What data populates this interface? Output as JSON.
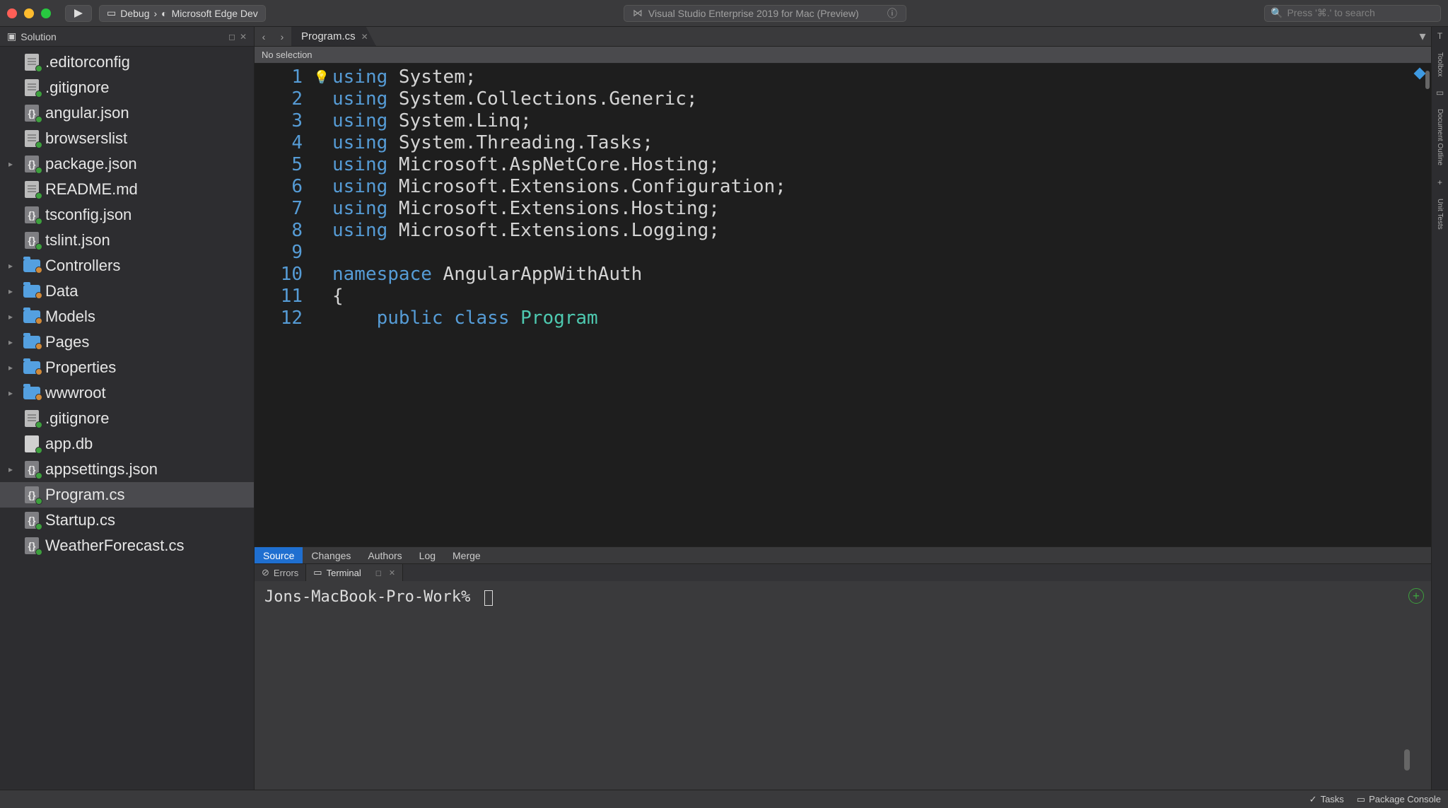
{
  "titlebar": {
    "run_tooltip": "Run",
    "config_label": "Debug",
    "config_sep": "›",
    "target_label": "Microsoft Edge Dev",
    "center_title": "Visual Studio Enterprise 2019 for Mac (Preview)",
    "search_placeholder": "Press '⌘.' to search"
  },
  "sidebar": {
    "title": "Solution",
    "items": [
      {
        "name": ".editorconfig",
        "icon": "doc",
        "expandable": false,
        "badge": "add"
      },
      {
        "name": ".gitignore",
        "icon": "doc",
        "expandable": false,
        "badge": "add"
      },
      {
        "name": "angular.json",
        "icon": "json",
        "expandable": false,
        "badge": "add"
      },
      {
        "name": "browserslist",
        "icon": "doc",
        "expandable": false,
        "badge": "add"
      },
      {
        "name": "package.json",
        "icon": "json",
        "expandable": true,
        "badge": "add"
      },
      {
        "name": "README.md",
        "icon": "doc",
        "expandable": false,
        "badge": "add"
      },
      {
        "name": "tsconfig.json",
        "icon": "json",
        "expandable": false,
        "badge": "add"
      },
      {
        "name": "tslint.json",
        "icon": "json",
        "expandable": false,
        "badge": "add"
      },
      {
        "name": "Controllers",
        "icon": "folder",
        "expandable": true,
        "badge": "mod"
      },
      {
        "name": "Data",
        "icon": "folder",
        "expandable": true,
        "badge": "mod"
      },
      {
        "name": "Models",
        "icon": "folder",
        "expandable": true,
        "badge": "mod"
      },
      {
        "name": "Pages",
        "icon": "folder",
        "expandable": true,
        "badge": "mod"
      },
      {
        "name": "Properties",
        "icon": "folder",
        "expandable": true,
        "badge": "mod"
      },
      {
        "name": "wwwroot",
        "icon": "folder",
        "expandable": true,
        "badge": "mod"
      },
      {
        "name": ".gitignore",
        "icon": "doc",
        "expandable": false,
        "badge": "add"
      },
      {
        "name": "app.db",
        "icon": "db",
        "expandable": false,
        "badge": "add"
      },
      {
        "name": "appsettings.json",
        "icon": "json",
        "expandable": true,
        "badge": "add"
      },
      {
        "name": "Program.cs",
        "icon": "json",
        "expandable": false,
        "badge": "add",
        "selected": true
      },
      {
        "name": "Startup.cs",
        "icon": "json",
        "expandable": false,
        "badge": "add"
      },
      {
        "name": "WeatherForecast.cs",
        "icon": "json",
        "expandable": false,
        "badge": "add"
      }
    ]
  },
  "editor": {
    "tab_label": "Program.cs",
    "breadcrumb": "No selection",
    "code_lines": [
      [
        [
          "kw",
          "using"
        ],
        [
          "",
          " System;"
        ]
      ],
      [
        [
          "kw",
          "using"
        ],
        [
          "",
          " System.Collections.Generic;"
        ]
      ],
      [
        [
          "kw",
          "using"
        ],
        [
          "",
          " System.Linq;"
        ]
      ],
      [
        [
          "kw",
          "using"
        ],
        [
          "",
          " System.Threading.Tasks;"
        ]
      ],
      [
        [
          "kw",
          "using"
        ],
        [
          "",
          " Microsoft.AspNetCore.Hosting;"
        ]
      ],
      [
        [
          "kw",
          "using"
        ],
        [
          "",
          " Microsoft.Extensions.Configuration;"
        ]
      ],
      [
        [
          "kw",
          "using"
        ],
        [
          "",
          " Microsoft.Extensions.Hosting;"
        ]
      ],
      [
        [
          "kw",
          "using"
        ],
        [
          "",
          " Microsoft.Extensions.Logging;"
        ]
      ],
      [
        [
          "",
          ""
        ]
      ],
      [
        [
          "kw",
          "namespace"
        ],
        [
          "",
          " AngularAppWithAuth"
        ]
      ],
      [
        [
          "",
          "{"
        ]
      ],
      [
        [
          "",
          "    "
        ],
        [
          "kw",
          "public"
        ],
        [
          "",
          " "
        ],
        [
          "kw",
          "class"
        ],
        [
          "",
          " "
        ],
        [
          "cls",
          "Program"
        ]
      ]
    ],
    "src_tabs": [
      "Source",
      "Changes",
      "Authors",
      "Log",
      "Merge"
    ],
    "src_active": "Source"
  },
  "bottom": {
    "tabs": [
      {
        "label": "Errors",
        "icon": "error-icon",
        "active": false
      },
      {
        "label": "Terminal",
        "icon": "terminal-icon",
        "active": true
      }
    ],
    "terminal_prompt": "Jons-MacBook-Pro-Work%"
  },
  "rightstrip": {
    "items": [
      "Toolbox",
      "Document Outline",
      "Unit Tests"
    ],
    "icons": [
      "T",
      "▭",
      "+"
    ]
  },
  "statusbar": {
    "tasks_label": "Tasks",
    "package_label": "Package Console"
  }
}
